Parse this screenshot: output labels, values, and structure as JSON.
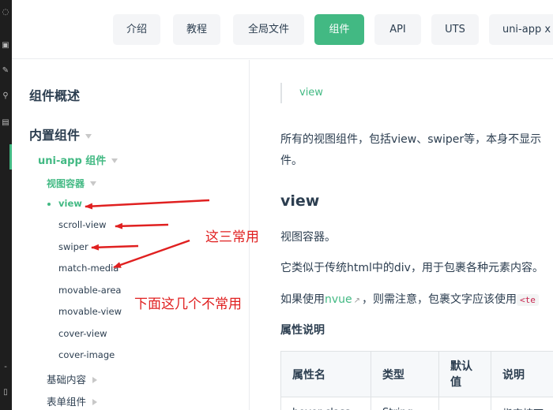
{
  "topnav": {
    "items": [
      {
        "label": "介绍",
        "active": false
      },
      {
        "label": "教程",
        "active": false
      },
      {
        "label": "全局文件",
        "active": false
      },
      {
        "label": "组件",
        "active": true
      },
      {
        "label": "API",
        "active": false
      },
      {
        "label": "UTS",
        "active": false
      },
      {
        "label": "uni-app x",
        "active": false
      }
    ]
  },
  "sidebar": {
    "overview": "组件概述",
    "builtin": "内置组件",
    "uniapp_group": "uni-app 组件",
    "view_container": "视图容器",
    "items": [
      "view",
      "scroll-view",
      "swiper",
      "match-media",
      "movable-area",
      "movable-view",
      "cover-view",
      "cover-image"
    ],
    "active_item": "view",
    "collapsed": [
      "基础内容",
      "表单组件"
    ]
  },
  "main": {
    "breadcrumb": "view",
    "intro_line1": "所有的视图组件，包括view、swiper等，本身不显示",
    "intro_line2": "件。",
    "heading": "view",
    "desc1": "视图容器。",
    "desc2": "它类似于传统html中的div，用于包裹各种元素内容。",
    "nvue_pre": "如果使用",
    "nvue_link": "nvue",
    "nvue_post": "，则需注意，包裹文字应该使用",
    "nvue_code": "<te",
    "attr_heading": "属性说明",
    "table_headers": [
      "属性名",
      "类型",
      "默认值",
      "说明"
    ],
    "table_row": [
      "hover-class",
      "String",
      "",
      "指定按下"
    ]
  },
  "annotations": {
    "common": "这三常用",
    "uncommon": "下面这几个不常用"
  },
  "colors": {
    "accent": "#42b983",
    "annotation": "#e02020",
    "strip": "#1e1e1e"
  }
}
